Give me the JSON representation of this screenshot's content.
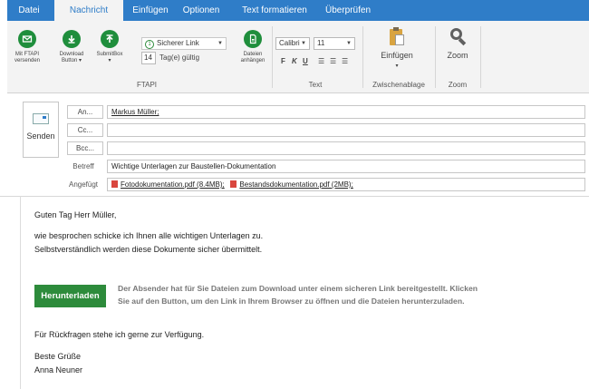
{
  "tabs": [
    {
      "label": "Datei",
      "active": false
    },
    {
      "label": "Nachricht",
      "active": true
    },
    {
      "label": "Einfügen",
      "active": false
    },
    {
      "label": "Optionen",
      "active": false
    },
    {
      "label": "Text formatieren",
      "active": false
    },
    {
      "label": "Überprüfen",
      "active": false
    }
  ],
  "ribbon": {
    "ftapi": {
      "mit_ftapi": "Mit FTAPI versenden",
      "download_button": "Download Button",
      "submitbox": "SubmitBox",
      "link_option": "Sicherer Link",
      "link_option_number": "1",
      "days": "14",
      "days_label": "Tag(e) gültig",
      "attach": "Dateien anhängen",
      "group_label": "FTAPI"
    },
    "text": {
      "font": "Calibri",
      "size": "11",
      "bold": "F",
      "italic": "K",
      "underline": "U",
      "group_label": "Text"
    },
    "clipboard": {
      "paste": "Einfügen",
      "group_label": "Zwischenablage"
    },
    "zoom": {
      "label": "Zoom",
      "group_label": "Zoom"
    }
  },
  "header": {
    "send_label": "Senden",
    "to_button": "An...",
    "cc_button": "Cc...",
    "bcc_button": "Bcc...",
    "to_value": "Markus Müller;",
    "cc_value": "",
    "bcc_value": "",
    "subject_label": "Betreff",
    "subject_value": "Wichtige Unterlagen zur Baustellen-Dokumentation",
    "attached_label": "Angefügt",
    "attachments": [
      "Fotodokumentation.pdf (8.4MB);",
      "Bestandsdokumentation.pdf (2MB);"
    ]
  },
  "body": {
    "greeting": "Guten Tag Herr Müller,",
    "line1": "wie besprochen schicke ich Ihnen alle wichtigen Unterlagen zu.",
    "line2": "Selbstverständlich werden diese Dokumente sicher übermittelt.",
    "download_button": "Herunterladen",
    "download_text1": "Der Absender hat für Sie Dateien zum Download unter einem sicheren Link bereitgestellt. Klicken",
    "download_text2": "Sie auf den Button, um den Link in Ihrem Browser zu öffnen und die Dateien herunterzuladen.",
    "questions": "Für Rückfragen stehe ich gerne zur Verfügung.",
    "closing": "Beste Grüße",
    "signature": "Anna Neuner"
  },
  "colors": {
    "accent": "#2f7dc8",
    "ftapi_green": "#1f8e3c",
    "download_green": "#2d8b3b"
  }
}
